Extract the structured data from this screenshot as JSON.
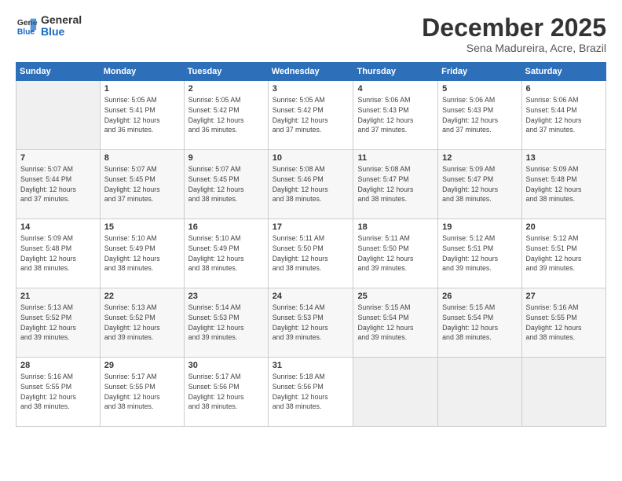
{
  "logo": {
    "line1": "General",
    "line2": "Blue"
  },
  "header": {
    "title": "December 2025",
    "subtitle": "Sena Madureira, Acre, Brazil"
  },
  "weekdays": [
    "Sunday",
    "Monday",
    "Tuesday",
    "Wednesday",
    "Thursday",
    "Friday",
    "Saturday"
  ],
  "weeks": [
    [
      {
        "day": "",
        "sunrise": "",
        "sunset": "",
        "daylight": ""
      },
      {
        "day": "1",
        "sunrise": "5:05 AM",
        "sunset": "5:41 PM",
        "daylight": "12 hours and 36 minutes."
      },
      {
        "day": "2",
        "sunrise": "5:05 AM",
        "sunset": "5:42 PM",
        "daylight": "12 hours and 36 minutes."
      },
      {
        "day": "3",
        "sunrise": "5:05 AM",
        "sunset": "5:42 PM",
        "daylight": "12 hours and 37 minutes."
      },
      {
        "day": "4",
        "sunrise": "5:06 AM",
        "sunset": "5:43 PM",
        "daylight": "12 hours and 37 minutes."
      },
      {
        "day": "5",
        "sunrise": "5:06 AM",
        "sunset": "5:43 PM",
        "daylight": "12 hours and 37 minutes."
      },
      {
        "day": "6",
        "sunrise": "5:06 AM",
        "sunset": "5:44 PM",
        "daylight": "12 hours and 37 minutes."
      }
    ],
    [
      {
        "day": "7",
        "sunrise": "5:07 AM",
        "sunset": "5:44 PM",
        "daylight": "12 hours and 37 minutes."
      },
      {
        "day": "8",
        "sunrise": "5:07 AM",
        "sunset": "5:45 PM",
        "daylight": "12 hours and 37 minutes."
      },
      {
        "day": "9",
        "sunrise": "5:07 AM",
        "sunset": "5:45 PM",
        "daylight": "12 hours and 38 minutes."
      },
      {
        "day": "10",
        "sunrise": "5:08 AM",
        "sunset": "5:46 PM",
        "daylight": "12 hours and 38 minutes."
      },
      {
        "day": "11",
        "sunrise": "5:08 AM",
        "sunset": "5:47 PM",
        "daylight": "12 hours and 38 minutes."
      },
      {
        "day": "12",
        "sunrise": "5:09 AM",
        "sunset": "5:47 PM",
        "daylight": "12 hours and 38 minutes."
      },
      {
        "day": "13",
        "sunrise": "5:09 AM",
        "sunset": "5:48 PM",
        "daylight": "12 hours and 38 minutes."
      }
    ],
    [
      {
        "day": "14",
        "sunrise": "5:09 AM",
        "sunset": "5:48 PM",
        "daylight": "12 hours and 38 minutes."
      },
      {
        "day": "15",
        "sunrise": "5:10 AM",
        "sunset": "5:49 PM",
        "daylight": "12 hours and 38 minutes."
      },
      {
        "day": "16",
        "sunrise": "5:10 AM",
        "sunset": "5:49 PM",
        "daylight": "12 hours and 38 minutes."
      },
      {
        "day": "17",
        "sunrise": "5:11 AM",
        "sunset": "5:50 PM",
        "daylight": "12 hours and 38 minutes."
      },
      {
        "day": "18",
        "sunrise": "5:11 AM",
        "sunset": "5:50 PM",
        "daylight": "12 hours and 39 minutes."
      },
      {
        "day": "19",
        "sunrise": "5:12 AM",
        "sunset": "5:51 PM",
        "daylight": "12 hours and 39 minutes."
      },
      {
        "day": "20",
        "sunrise": "5:12 AM",
        "sunset": "5:51 PM",
        "daylight": "12 hours and 39 minutes."
      }
    ],
    [
      {
        "day": "21",
        "sunrise": "5:13 AM",
        "sunset": "5:52 PM",
        "daylight": "12 hours and 39 minutes."
      },
      {
        "day": "22",
        "sunrise": "5:13 AM",
        "sunset": "5:52 PM",
        "daylight": "12 hours and 39 minutes."
      },
      {
        "day": "23",
        "sunrise": "5:14 AM",
        "sunset": "5:53 PM",
        "daylight": "12 hours and 39 minutes."
      },
      {
        "day": "24",
        "sunrise": "5:14 AM",
        "sunset": "5:53 PM",
        "daylight": "12 hours and 39 minutes."
      },
      {
        "day": "25",
        "sunrise": "5:15 AM",
        "sunset": "5:54 PM",
        "daylight": "12 hours and 39 minutes."
      },
      {
        "day": "26",
        "sunrise": "5:15 AM",
        "sunset": "5:54 PM",
        "daylight": "12 hours and 38 minutes."
      },
      {
        "day": "27",
        "sunrise": "5:16 AM",
        "sunset": "5:55 PM",
        "daylight": "12 hours and 38 minutes."
      }
    ],
    [
      {
        "day": "28",
        "sunrise": "5:16 AM",
        "sunset": "5:55 PM",
        "daylight": "12 hours and 38 minutes."
      },
      {
        "day": "29",
        "sunrise": "5:17 AM",
        "sunset": "5:55 PM",
        "daylight": "12 hours and 38 minutes."
      },
      {
        "day": "30",
        "sunrise": "5:17 AM",
        "sunset": "5:56 PM",
        "daylight": "12 hours and 38 minutes."
      },
      {
        "day": "31",
        "sunrise": "5:18 AM",
        "sunset": "5:56 PM",
        "daylight": "12 hours and 38 minutes."
      },
      {
        "day": "",
        "sunrise": "",
        "sunset": "",
        "daylight": ""
      },
      {
        "day": "",
        "sunrise": "",
        "sunset": "",
        "daylight": ""
      },
      {
        "day": "",
        "sunrise": "",
        "sunset": "",
        "daylight": ""
      }
    ]
  ]
}
